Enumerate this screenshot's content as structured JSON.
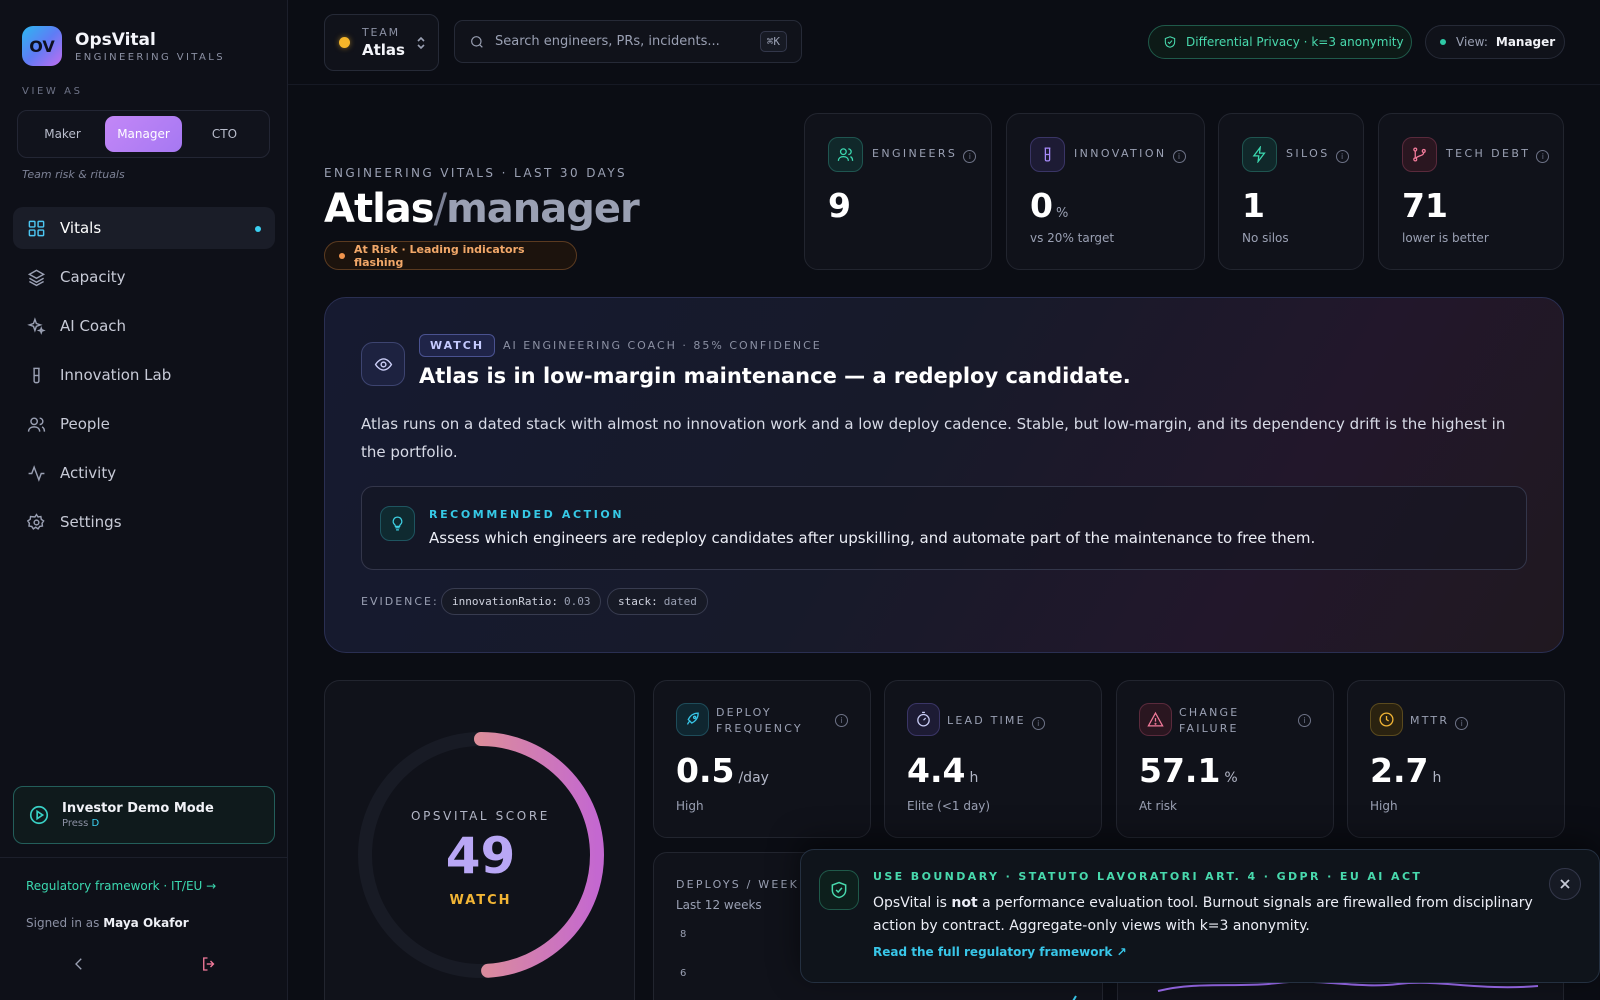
{
  "brand": {
    "logo": "OV",
    "name": "OpsVital",
    "subtitle": "ENGINEERING VITALS"
  },
  "sidebar": {
    "view_as_label": "VIEW AS",
    "roles": [
      "Maker",
      "Manager",
      "CTO"
    ],
    "active_role": "Manager",
    "role_caption": "Team risk & rituals",
    "nav": [
      {
        "label": "Vitals",
        "icon": "grid-icon",
        "active": true
      },
      {
        "label": "Capacity",
        "icon": "layers-icon"
      },
      {
        "label": "AI Coach",
        "icon": "sparkles-icon"
      },
      {
        "label": "Innovation Lab",
        "icon": "flask-icon"
      },
      {
        "label": "People",
        "icon": "users-icon"
      },
      {
        "label": "Activity",
        "icon": "activity-icon"
      },
      {
        "label": "Settings",
        "icon": "gear-icon"
      }
    ],
    "demo": {
      "title": "Investor Demo Mode",
      "press": "Press",
      "key": "D"
    },
    "regulatory_link": "Regulatory framework · IT/EU →",
    "signed_in_label": "Signed in as",
    "user": "Maya Okafor"
  },
  "topbar": {
    "team_label": "TEAM",
    "team_name": "Atlas",
    "search_placeholder": "Search engineers, PRs, incidents...",
    "search_shortcut": "⌘K",
    "privacy_pill": "Differential Privacy · k=3 anonymity",
    "view_label": "View:",
    "view_value": "Manager"
  },
  "header": {
    "eyebrow": "ENGINEERING VITALS · LAST 30 DAYS",
    "team": "Atlas",
    "separator": "/",
    "role": "manager",
    "status": "At Risk · Leading indicators flashing"
  },
  "kpis": [
    {
      "label": "ENGINEERS",
      "value": "9",
      "unit": "",
      "sub": "",
      "icon": "users-icon",
      "color": "#3bd9b0"
    },
    {
      "label": "INNOVATION",
      "value": "0",
      "unit": "%",
      "sub": "vs 20% target",
      "icon": "flask-icon",
      "color": "#a78bfa"
    },
    {
      "label": "SILOS",
      "value": "1",
      "unit": "",
      "sub": "No silos",
      "icon": "bolt-icon",
      "color": "#3bd9b0"
    },
    {
      "label": "TECH DEBT",
      "value": "71",
      "unit": "",
      "sub": "lower is better",
      "icon": "git-branch-icon",
      "color": "#f27a9a"
    }
  ],
  "coach": {
    "tag": "WATCH",
    "meta": "AI ENGINEERING COACH · 85% CONFIDENCE",
    "title": "Atlas is in low-margin maintenance — a redeploy candidate.",
    "body": "Atlas runs on a dated stack with almost no innovation work and a low deploy cadence. Stable, but low-margin, and its dependency drift is the highest in the portfolio.",
    "rec_label": "RECOMMENDED ACTION",
    "rec_text": "Assess which engineers are redeploy candidates after upskilling, and automate part of the maintenance to free them.",
    "evidence_label": "EVIDENCE:",
    "evidence": [
      {
        "key": "innovationRatio:",
        "value": "0.03"
      },
      {
        "key": "stack:",
        "value": "dated"
      }
    ]
  },
  "score": {
    "label": "OPSVITAL SCORE",
    "value": "49",
    "value_num": 49,
    "status": "WATCH"
  },
  "dora": [
    {
      "label_lines": [
        "DEPLOY",
        "FREQUENCY"
      ],
      "value": "0.5",
      "unit": "/day",
      "sub": "High",
      "icon": "rocket-icon",
      "color": "#38c6e8"
    },
    {
      "label_lines": [
        "LEAD TIME"
      ],
      "value": "4.4",
      "unit": "h",
      "sub": "Elite (<1 day)",
      "icon": "timer-icon",
      "color": "#a78bfa"
    },
    {
      "label_lines": [
        "CHANGE",
        "FAILURE"
      ],
      "value": "57.1",
      "unit": "%",
      "sub": "At risk",
      "icon": "warning-icon",
      "color": "#f27a9a"
    },
    {
      "label_lines": [
        "MTTR"
      ],
      "value": "2.7",
      "unit": "h",
      "sub": "High",
      "icon": "clock-icon",
      "color": "#f2b535"
    }
  ],
  "deploys": {
    "title": "DEPLOYS / WEEK",
    "subtitle": "Last 12 weeks",
    "y_ticks": [
      "8",
      "6"
    ]
  },
  "boundary": {
    "label": "USE BOUNDARY · STATUTO LAVORATORI ART. 4 · GDPR · EU AI ACT",
    "text_a": "OpsVital is",
    "text_b": "not",
    "text_c": "a performance evaluation tool. Burnout signals are firewalled from disciplinary action by contract. Aggregate-only views with k=3 anonymity.",
    "link": "Read the full regulatory framework ↗"
  }
}
